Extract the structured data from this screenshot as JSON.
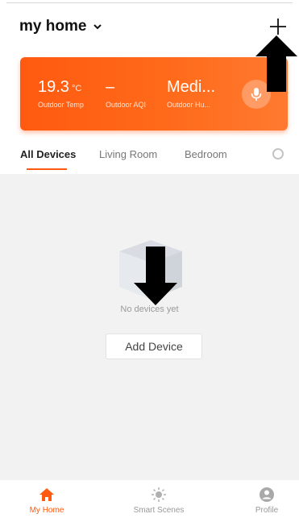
{
  "header": {
    "home_name": "my home"
  },
  "weather": {
    "temp_value": "19.3",
    "temp_unit": "°C",
    "temp_label": "Outdoor Temp",
    "aqi_value": "–",
    "aqi_label": "Outdoor AQI",
    "humidity_value": "Medi...",
    "humidity_label": "Outdoor Hu..."
  },
  "tabs": [
    {
      "label": "All Devices"
    },
    {
      "label": "Living Room"
    },
    {
      "label": "Bedroom"
    }
  ],
  "empty_state": {
    "message": "No devices yet",
    "button_label": "Add Device"
  },
  "bottom_nav": [
    {
      "label": "My Home"
    },
    {
      "label": "Smart Scenes"
    },
    {
      "label": "Profile"
    }
  ],
  "colors": {
    "accent": "#ff5a10",
    "card_gradient_start": "#ff5a10",
    "card_gradient_end": "#ff7a30",
    "content_background": "#f2f2f2"
  },
  "icons": {
    "home_dropdown": "chevron-down-icon",
    "add": "plus-icon",
    "voice": "microphone-icon",
    "tab_settings": "settings-circle-icon",
    "empty": "box-icon",
    "nav_home": "home-icon",
    "nav_scenes": "sun-icon",
    "nav_profile": "profile-icon"
  }
}
